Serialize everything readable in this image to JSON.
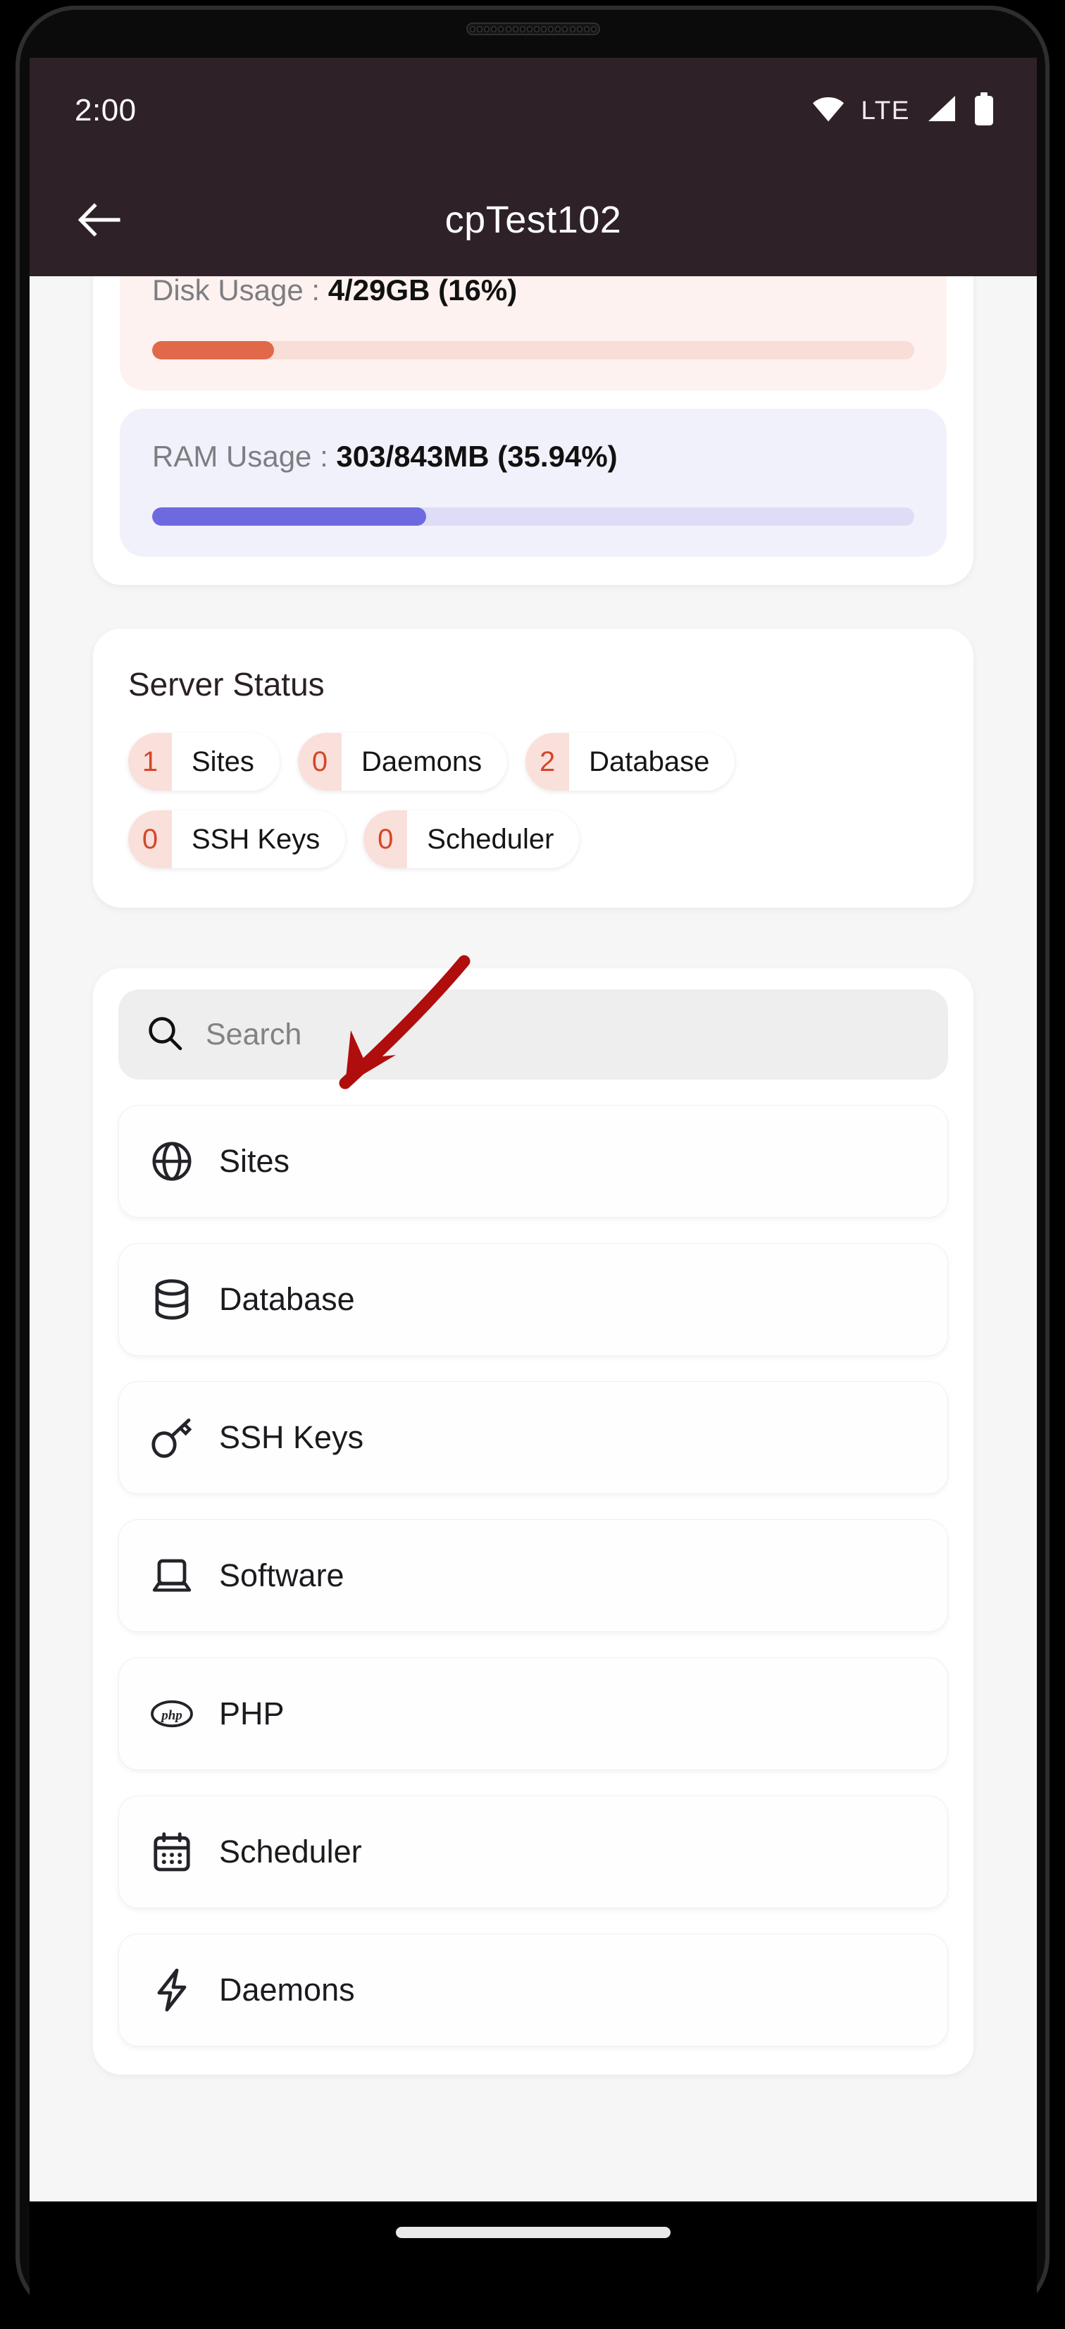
{
  "status_bar": {
    "time": "2:00",
    "network_label": "LTE",
    "icons": [
      "wifi-icon",
      "signal-icon",
      "battery-icon"
    ]
  },
  "app_bar": {
    "back_icon": "arrow-left-icon",
    "title": "cpTest102"
  },
  "usage": {
    "disk": {
      "label": "Disk Usage : ",
      "value": "4/29GB (16%)",
      "percent": 16,
      "fill_color": "#e2684a",
      "track_color": "#f8ded6",
      "panel_color": "#fdf2ef"
    },
    "ram": {
      "label": "RAM Usage : ",
      "value": "303/843MB (35.94%)",
      "percent": 35.94,
      "fill_color": "#6d6ae0",
      "track_color": "#dedcf6",
      "panel_color": "#f1f1fb"
    }
  },
  "server_status": {
    "title": "Server Status",
    "count_color": "#d4462a",
    "count_bg": "#fae0da",
    "pills": [
      {
        "count": "1",
        "label": "Sites"
      },
      {
        "count": "0",
        "label": "Daemons"
      },
      {
        "count": "2",
        "label": "Database"
      },
      {
        "count": "0",
        "label": "SSH Keys"
      },
      {
        "count": "0",
        "label": "Scheduler"
      }
    ]
  },
  "search": {
    "icon": "search-icon",
    "placeholder": "Search",
    "value": ""
  },
  "menu": {
    "items": [
      {
        "label": "Sites",
        "icon": "globe-icon"
      },
      {
        "label": "Database",
        "icon": "database-icon"
      },
      {
        "label": "SSH Keys",
        "icon": "key-icon"
      },
      {
        "label": "Software",
        "icon": "laptop-icon"
      },
      {
        "label": "PHP",
        "icon": "php-icon"
      },
      {
        "label": "Scheduler",
        "icon": "calendar-icon"
      },
      {
        "label": "Daemons",
        "icon": "lightning-bolt-icon"
      }
    ]
  },
  "annotation": {
    "type": "arrow",
    "color": "#b00d0d",
    "points_to": "Sites"
  }
}
